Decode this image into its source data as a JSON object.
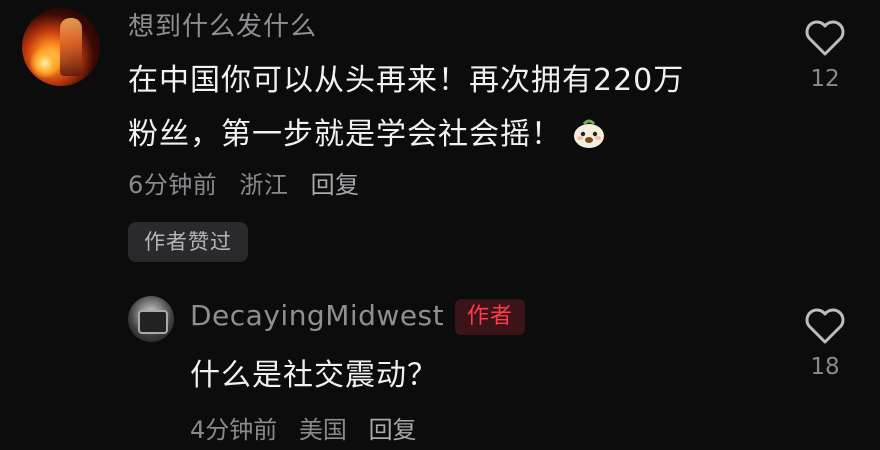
{
  "comments": [
    {
      "username": "想到什么发什么",
      "text_line1": "在中国你可以从头再来！再次拥有220万",
      "text_line2": "粉丝，第一步就是学会社会摇！",
      "emoji": "peach-face-emoji",
      "time": "6分钟前",
      "location": "浙江",
      "reply_label": "回复",
      "badge": "作者赞过",
      "likes": "12"
    },
    {
      "username": "DecayingMidwest",
      "author_tag": "作者",
      "text": "什么是社交震动？",
      "time": "4分钟前",
      "location": "美国",
      "reply_label": "回复",
      "likes": "18"
    }
  ],
  "colors": {
    "background": "#0c0c0d",
    "primary_text": "#f1f1f1",
    "secondary_text": "#8a8a8e",
    "author_tag": "#ff3a4a"
  }
}
